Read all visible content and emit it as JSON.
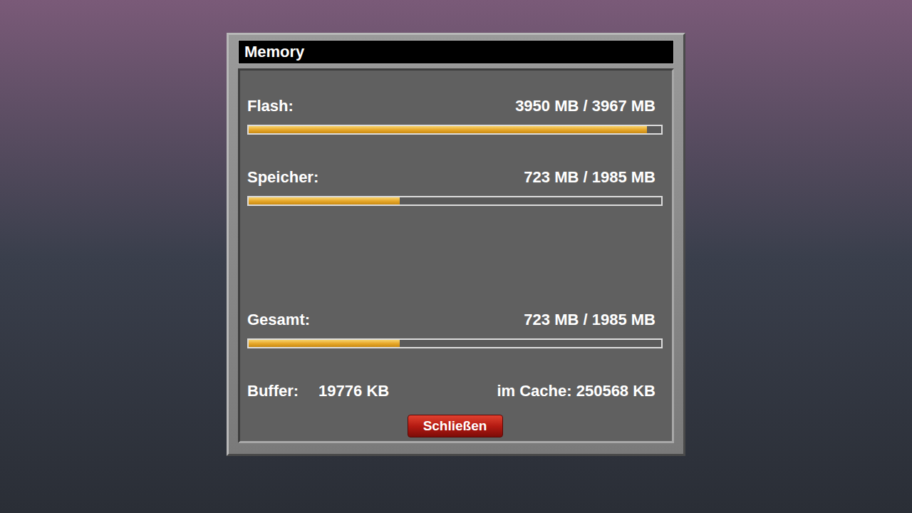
{
  "window": {
    "title": "Memory"
  },
  "memory": [
    {
      "label": "Flash:",
      "value": "3950 MB / 3967 MB",
      "level": 0.965
    },
    {
      "label": "Speicher:",
      "value": "723 MB / 1985 MB",
      "level": 0.366
    }
  ],
  "total": {
    "label": "Gesamt:",
    "value": "723 MB / 1985 MB",
    "level": 0.366
  },
  "buffer": {
    "label": "Buffer:",
    "value": "19776 KB",
    "cache": "im Cache: 250568 KB"
  },
  "buttons": [
    "Schließen"
  ]
}
